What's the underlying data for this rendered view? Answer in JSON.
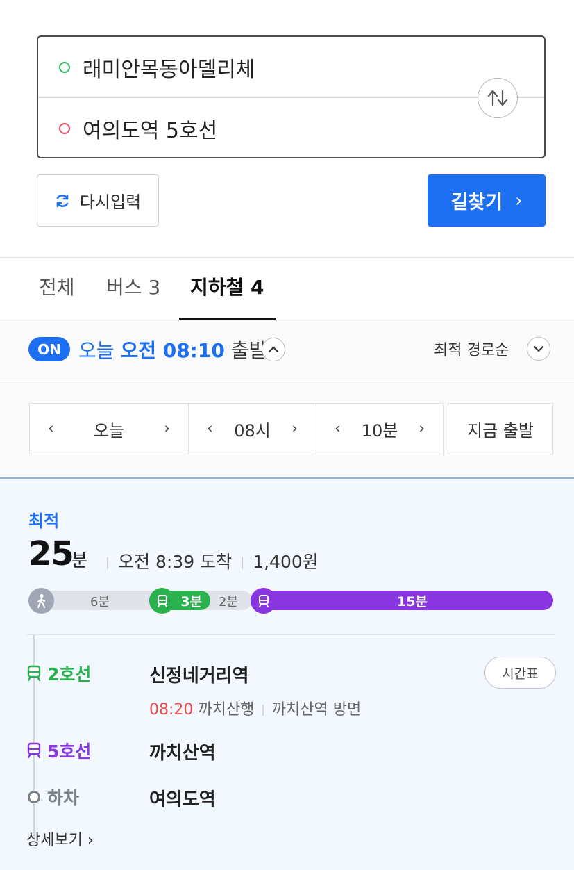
{
  "search": {
    "origin": "래미안목동아델리체",
    "destination": "여의도역 5호선",
    "reset_label": "다시입력",
    "find_label": "길찾기",
    "find_chevron": "›"
  },
  "tabs": [
    {
      "label": "전체",
      "active": false
    },
    {
      "label": "버스 3",
      "active": false
    },
    {
      "label": "지하철 4",
      "active": true
    }
  ],
  "departure": {
    "on_badge": "ON",
    "prefix": "오늘",
    "time_bold": "오전 08:10",
    "suffix": "출발",
    "sort_label": "최적 경로순"
  },
  "time_selector": {
    "day": "오늘",
    "hour": "08시",
    "minute": "10분",
    "now_label": "지금 출발",
    "prev": "‹",
    "next": "›"
  },
  "route": {
    "badge": "최적",
    "duration_value": "25",
    "duration_unit": "분",
    "arrival": "오전 8:39 도착",
    "fare": "1,400원",
    "segments": {
      "walk": "6분",
      "line2": "3분",
      "transfer": "2분",
      "line5": "15분"
    },
    "steps": [
      {
        "line": "2호선",
        "color": "#2ab24f",
        "station": "신정네거리역"
      },
      {
        "line": "5호선",
        "color": "#8935e0",
        "station": "까치산역"
      },
      {
        "line": "하차",
        "color": "#7a7f88",
        "station": "여의도역"
      }
    ],
    "sub_time": "08:20",
    "sub_direction": "까치산행",
    "sub_platform": "까치산역 방면",
    "timetable_label": "시간표",
    "detail_label": "상세보기",
    "detail_chevron": "›"
  },
  "colors": {
    "accent": "#1b6ff0",
    "line2": "#2ab24f",
    "line5": "#8935e0",
    "walk": "#a0a6b3"
  }
}
